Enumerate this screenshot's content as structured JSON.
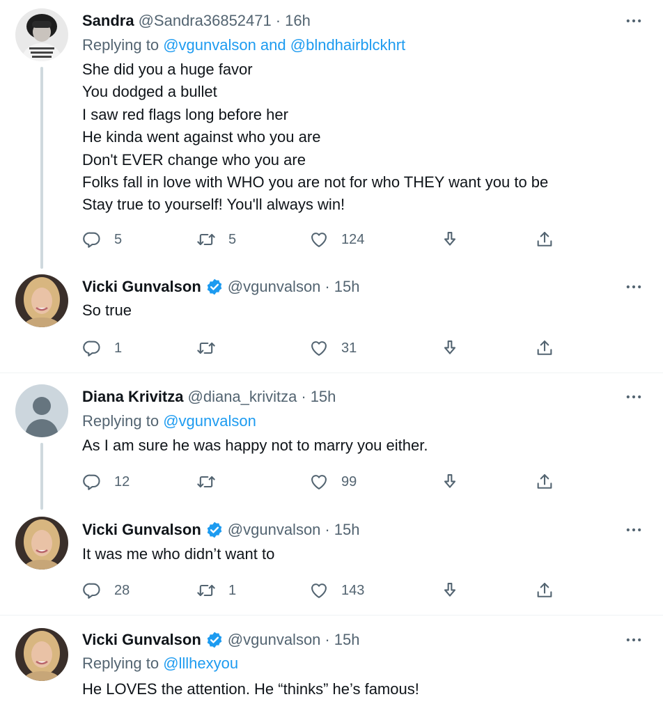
{
  "tweets": [
    {
      "name": "Sandra",
      "handle": "@Sandra36852471",
      "dot": "·",
      "time": "16h",
      "verified": false,
      "avatar_icon": "child-tshirt-avatar-icon",
      "replying_prefix": "Replying to ",
      "replying_links": "@vgunvalson and @blndhairblckhrt",
      "lines": [
        "She did you a huge favor",
        "You dodged a bullet",
        "I saw red flags long before her",
        "He kinda went against who you are",
        "Don't EVER change who you are",
        "Folks fall in love with WHO you are not for who THEY want you to be",
        "Stay true to yourself! You'll always win!"
      ],
      "replies": "5",
      "retweets": "5",
      "likes": "124"
    },
    {
      "name": "Vicki Gunvalson",
      "handle": "@vgunvalson",
      "dot": "·",
      "time": "15h",
      "verified": true,
      "avatar_icon": "blonde-woman-avatar-icon",
      "lines": [
        "So true"
      ],
      "replies": "1",
      "retweets": "",
      "likes": "31"
    },
    {
      "name": "Diana Krivitza",
      "handle": "@diana_krivitza",
      "dot": "·",
      "time": "15h",
      "verified": false,
      "avatar_icon": "default-avatar-icon",
      "replying_prefix": "Replying to ",
      "replying_links": "@vgunvalson",
      "lines": [
        "As I am sure he was happy not to marry you either."
      ],
      "replies": "12",
      "retweets": "",
      "likes": "99"
    },
    {
      "name": "Vicki Gunvalson",
      "handle": "@vgunvalson",
      "dot": "·",
      "time": "15h",
      "verified": true,
      "avatar_icon": "blonde-woman-avatar-icon",
      "lines": [
        "It was me who didn’t want to"
      ],
      "replies": "28",
      "retweets": "1",
      "likes": "143"
    },
    {
      "name": "Vicki Gunvalson",
      "handle": "@vgunvalson",
      "dot": "·",
      "time": "15h",
      "verified": true,
      "avatar_icon": "blonde-woman-avatar-icon",
      "replying_prefix": "Replying to ",
      "replying_links": "@lllhexyou",
      "lines": [
        "He LOVES the attention.  He “thinks” he’s famous!"
      ]
    }
  ],
  "colors": {
    "text": "#0f1419",
    "secondary": "#536471",
    "link": "#1d9bf0",
    "verified": "#1d9bf0",
    "thread_line": "#cfd9de",
    "divider": "#eff3f4"
  }
}
